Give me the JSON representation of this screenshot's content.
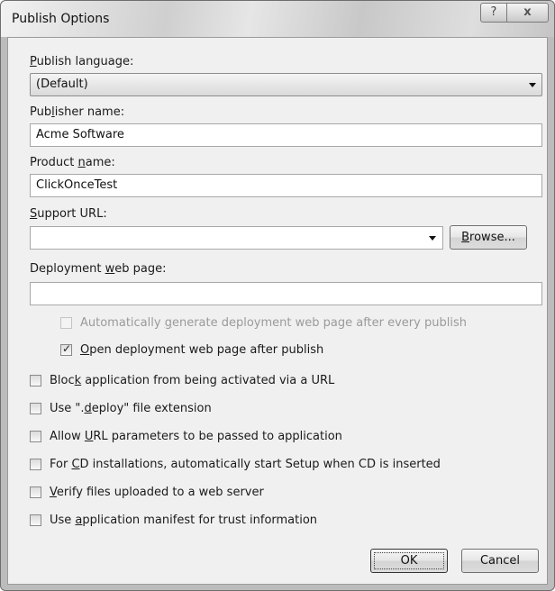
{
  "window": {
    "title": "Publish Options",
    "help_glyph": "?",
    "close_glyph": "x"
  },
  "publish_language": {
    "label_pre": "",
    "label_key": "P",
    "label_post": "ublish language:",
    "value": "(Default)"
  },
  "publisher_name": {
    "label_pre": "Pub",
    "label_key": "l",
    "label_post": "isher name:",
    "value": "Acme Software"
  },
  "product_name": {
    "label_pre": "Product ",
    "label_key": "n",
    "label_post": "ame:",
    "value": "ClickOnceTest"
  },
  "support_url": {
    "label_pre": "",
    "label_key": "S",
    "label_post": "upport URL:",
    "value": "",
    "browse_pre": "",
    "browse_key": "B",
    "browse_post": "rowse..."
  },
  "deployment_page": {
    "label_pre": "Deployment ",
    "label_key": "w",
    "label_post": "eb page:",
    "value": ""
  },
  "options": {
    "auto_generate": {
      "pre": "Automatically ",
      "key": "g",
      "post": "enerate deployment web page after every publish",
      "checked": false,
      "enabled": false
    },
    "open_page": {
      "pre": "",
      "key": "O",
      "post": "pen deployment web page after publish",
      "checked": true,
      "enabled": true
    },
    "block_url": {
      "pre": "Bloc",
      "key": "k",
      "post": " application from being activated via a URL",
      "checked": false
    },
    "deploy_ext": {
      "pre": "Use \".",
      "key": "d",
      "post": "eploy\" file extension",
      "checked": false
    },
    "url_params": {
      "pre": "Allow ",
      "key": "U",
      "post": "RL parameters to be passed to application",
      "checked": false
    },
    "cd_setup": {
      "pre": "For ",
      "key": "C",
      "post": "D installations, automatically start Setup when CD is inserted",
      "checked": false
    },
    "verify_files": {
      "pre": "",
      "key": "V",
      "post": "erify files uploaded to a web server",
      "checked": false
    },
    "app_manifest": {
      "pre": "Use ",
      "key": "a",
      "post": "pplication manifest for trust information",
      "checked": false
    }
  },
  "buttons": {
    "ok": "OK",
    "cancel": "Cancel"
  }
}
